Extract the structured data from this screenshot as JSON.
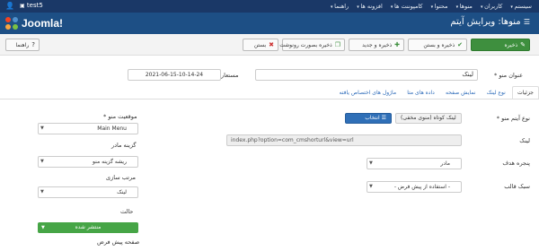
{
  "topbar": {
    "username": "test5",
    "menu": [
      "سیستم",
      "کاربران",
      "منوها",
      "محتوا",
      "کامپوننت ها",
      "افزونه ها",
      "راهنما"
    ]
  },
  "header": {
    "logo_text": "Joomla!",
    "title": "منوها: ویرایش آیتم"
  },
  "toolbar": {
    "save": "ذخیره",
    "save_close": "ذخیره و بستن",
    "save_new": "ذخیره و جدید",
    "save_copy": "ذخیره بصورت رونوشت",
    "close": "بستن",
    "help": "راهنما"
  },
  "form": {
    "title_label": "عنوان منو *",
    "title_value": "لینک",
    "alias_label": "مستعار",
    "alias_value": "2021-06-15-10-14-24"
  },
  "tabs": [
    "جزئیات",
    "نوع لینک",
    "نمایش صفحه",
    "داده های متا",
    "ماژول های اختصاص یافته"
  ],
  "details": {
    "type_label": "نوع آیتم منو *",
    "type_value": "لینک کوتاه (منوی مخفی)",
    "select_button": "انتخاب",
    "link_label": "لینک",
    "link_value": "index.php?option=com_cmshorturl&view=url",
    "target_label": "پنجره هدف",
    "target_value": "مادر",
    "template_label": "سبک قالب",
    "template_value": "- استفاده از پیش فرض -"
  },
  "sidebar": {
    "menu_label": "موقعیت منو *",
    "menu_value": "Main Menu",
    "parent_label": "گزینه مادر",
    "parent_value": "ریشه گزینه منو",
    "order_label": "مرتب سازی",
    "order_value": "لینک",
    "status_label": "حالت",
    "status_value": "منتشر شده",
    "default_label": "صفحه پیش فرض"
  }
}
